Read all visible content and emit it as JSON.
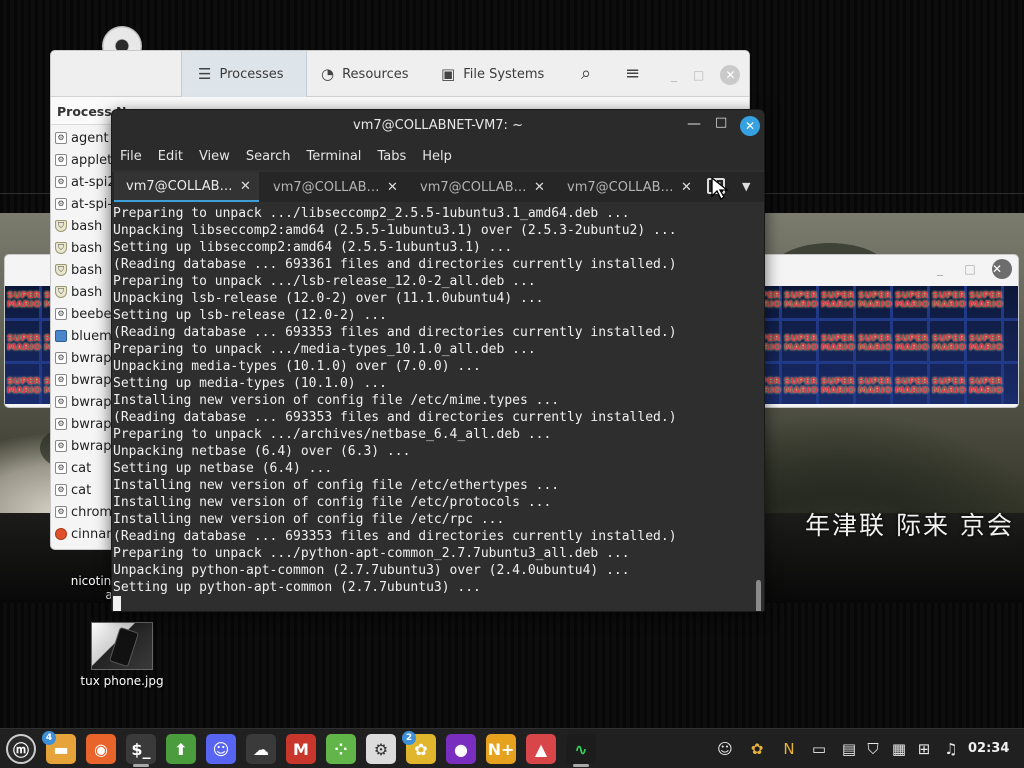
{
  "desktop": {
    "calligraphy": "年津联 际来 京会",
    "icons": [
      {
        "name": "nicotine",
        "label_line1": "nicotin",
        "label_line2": "al"
      },
      {
        "name": "tux-phone",
        "label": "tux phone.jpg"
      }
    ]
  },
  "system_monitor": {
    "tabs": [
      {
        "label": "Processes",
        "icon": "list-icon",
        "active": true
      },
      {
        "label": "Resources",
        "icon": "gauge-icon",
        "active": false
      },
      {
        "label": "File Systems",
        "icon": "disk-icon",
        "active": false
      }
    ],
    "column_header": "Process N",
    "processes": [
      {
        "name": "agent",
        "icon": "generic"
      },
      {
        "name": "applet",
        "icon": "generic"
      },
      {
        "name": "at-spi2",
        "icon": "generic"
      },
      {
        "name": "at-spi-",
        "icon": "generic"
      },
      {
        "name": "bash",
        "icon": "shield"
      },
      {
        "name": "bash",
        "icon": "shield"
      },
      {
        "name": "bash",
        "icon": "shield"
      },
      {
        "name": "bash",
        "icon": "shield"
      },
      {
        "name": "beebee",
        "icon": "generic"
      },
      {
        "name": "bluema",
        "icon": "blue"
      },
      {
        "name": "bwrap",
        "icon": "generic"
      },
      {
        "name": "bwrap",
        "icon": "generic"
      },
      {
        "name": "bwrap",
        "icon": "generic"
      },
      {
        "name": "bwrap",
        "icon": "generic"
      },
      {
        "name": "bwrap",
        "icon": "generic"
      },
      {
        "name": "cat",
        "icon": "generic"
      },
      {
        "name": "cat",
        "icon": "generic"
      },
      {
        "name": "chrome",
        "icon": "generic"
      },
      {
        "name": "cinnam",
        "icon": "orange"
      }
    ]
  },
  "mario_window": {
    "tile_text_top": "SUPER",
    "tile_text_bottom": "MARIO"
  },
  "terminal": {
    "title": "vm7@COLLABNET-VM7: ~",
    "menu": [
      "File",
      "Edit",
      "View",
      "Search",
      "Terminal",
      "Tabs",
      "Help"
    ],
    "tabs": [
      {
        "label": "vm7@COLLAB…",
        "active": true
      },
      {
        "label": "vm7@COLLAB…",
        "active": false
      },
      {
        "label": "vm7@COLLAB…",
        "active": false
      },
      {
        "label": "vm7@COLLAB…",
        "active": false
      }
    ],
    "lines": [
      "Preparing to unpack .../libseccomp2_2.5.5-1ubuntu3.1_amd64.deb ...",
      "Unpacking libseccomp2:amd64 (2.5.5-1ubuntu3.1) over (2.5.3-2ubuntu2) ...",
      "Setting up libseccomp2:amd64 (2.5.5-1ubuntu3.1) ...",
      "(Reading database ... 693361 files and directories currently installed.)",
      "Preparing to unpack .../lsb-release_12.0-2_all.deb ...",
      "Unpacking lsb-release (12.0-2) over (11.1.0ubuntu4) ...",
      "Setting up lsb-release (12.0-2) ...",
      "(Reading database ... 693353 files and directories currently installed.)",
      "Preparing to unpack .../media-types_10.1.0_all.deb ...",
      "Unpacking media-types (10.1.0) over (7.0.0) ...",
      "Setting up media-types (10.1.0) ...",
      "Installing new version of config file /etc/mime.types ...",
      "(Reading database ... 693353 files and directories currently installed.)",
      "Preparing to unpack .../archives/netbase_6.4_all.deb ...",
      "Unpacking netbase (6.4) over (6.3) ...",
      "Setting up netbase (6.4) ...",
      "Installing new version of config file /etc/ethertypes ...",
      "Installing new version of config file /etc/protocols ...",
      "Installing new version of config file /etc/rpc ...",
      "(Reading database ... 693353 files and directories currently installed.)",
      "Preparing to unpack .../python-apt-common_2.7.7ubuntu3_all.deb ...",
      "Unpacking python-apt-common (2.7.7ubuntu3) over (2.4.0ubuntu4) ...",
      "Setting up python-apt-common (2.7.7ubuntu3) ..."
    ]
  },
  "taskbar": {
    "clock": "02:34",
    "apps": [
      {
        "name": "menu",
        "icon": "mint-logo-icon",
        "color": "#2b2b2b"
      },
      {
        "name": "files",
        "icon": "folder-icon",
        "color": "#e6a33a",
        "badge": "4"
      },
      {
        "name": "firefox",
        "icon": "firefox-icon",
        "color": "#e9642a"
      },
      {
        "name": "terminal",
        "icon": "terminal-icon",
        "color": "#3a3a3a",
        "active": true
      },
      {
        "name": "update-manager",
        "icon": "shield-arrow-icon",
        "color": "#4b9c3c"
      },
      {
        "name": "discord",
        "icon": "discord-icon",
        "color": "#5865f2"
      },
      {
        "name": "cloud",
        "icon": "cloud-icon",
        "color": "#3a3a3a"
      },
      {
        "name": "mario",
        "icon": "mario-icon",
        "color": "#c8362c"
      },
      {
        "name": "grid-app",
        "icon": "grid-icon",
        "color": "#62b549"
      },
      {
        "name": "settings",
        "icon": "gear-icon",
        "color": "#dcdcdc"
      },
      {
        "name": "beebeep",
        "icon": "bee-icon",
        "color": "#e2b62c",
        "badge": "2"
      },
      {
        "name": "purple-app",
        "icon": "purple-orb-icon",
        "color": "#7a2ec0"
      },
      {
        "name": "n-plus",
        "icon": "n-plus-icon",
        "color": "#e6a21f"
      },
      {
        "name": "image-viewer",
        "icon": "image-icon",
        "color": "#d8464a"
      },
      {
        "name": "system-monitor",
        "icon": "pulse-icon",
        "color": "#1c1c1c",
        "active": true
      }
    ],
    "tray": [
      {
        "name": "discord-tray",
        "icon": "discord-icon"
      },
      {
        "name": "bee-tray",
        "icon": "bee-icon"
      },
      {
        "name": "n-plus-tray",
        "icon": "n-plus-icon"
      },
      {
        "name": "drive-tray",
        "icon": "drive-icon"
      },
      {
        "name": "clipboard-tray",
        "icon": "clipboard-icon"
      },
      {
        "name": "shield-tray",
        "icon": "shield-icon"
      },
      {
        "name": "note-tray",
        "icon": "note-icon"
      },
      {
        "name": "network-tray",
        "icon": "network-icon"
      },
      {
        "name": "sound-tray",
        "icon": "music-icon"
      }
    ]
  }
}
